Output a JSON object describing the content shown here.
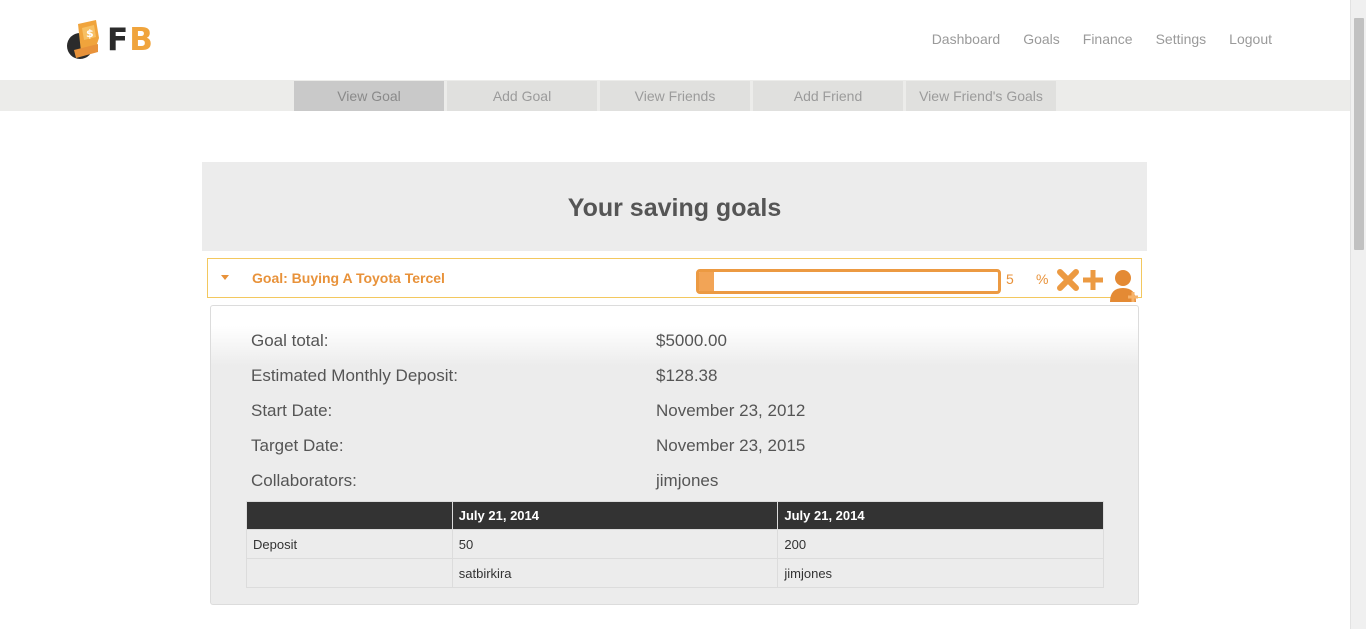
{
  "brand": {
    "logo_text_left": "F",
    "logo_text_right": "B",
    "accent": "#f0a43c"
  },
  "topnav": [
    "Dashboard",
    "Goals",
    "Finance",
    "Settings",
    "Logout"
  ],
  "subnav": [
    "View Goal",
    "Add Goal",
    "View Friends",
    "Add Friend",
    "View Friend's Goals"
  ],
  "subnav_active": "View Goal",
  "page_title": "Your saving goals",
  "goal": {
    "title": "Goal: Buying A Toyota Tercel",
    "progress_value": "5",
    "progress_percent": 5,
    "pct_sign": "%",
    "icons": [
      "delete-icon",
      "add-icon",
      "add-user-icon"
    ],
    "details": [
      {
        "label": "Goal total:",
        "value": "$5000.00"
      },
      {
        "label": "Estimated Monthly Deposit:",
        "value": "$128.38"
      },
      {
        "label": "Start Date:",
        "value": "November 23, 2012"
      },
      {
        "label": "Target Date:",
        "value": "November 23, 2015"
      },
      {
        "label": "Collaborators:",
        "value": "jimjones"
      }
    ],
    "table": {
      "headers": [
        "",
        "July 21, 2014",
        "July 21, 2014"
      ],
      "rows": [
        [
          "Deposit",
          "50",
          "200"
        ],
        [
          "",
          "satbirkira",
          "jimjones"
        ]
      ]
    }
  }
}
